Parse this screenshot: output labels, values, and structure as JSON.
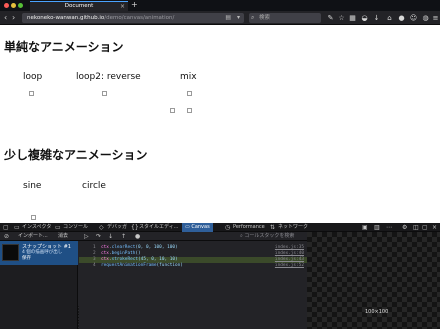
{
  "browser": {
    "tab_title": "Document",
    "tab_close": "×",
    "new_tab": "+",
    "url_host": "nekoneko-wanwan.github.io",
    "url_path": "/demo/canvas/animation/",
    "search_placeholder": "検索",
    "icons": [
      "back-arrow-icon",
      "forward-arrow-icon",
      "reader-icon",
      "search-icon",
      "pen-icon",
      "star-icon",
      "library-icon",
      "pocket-icon",
      "home-icon",
      "chat-icon",
      "smiley-icon",
      "menu-icon"
    ]
  },
  "page": {
    "section1_title": "単純なアニメーション",
    "loop": "loop",
    "loop2": "loop2: reverse",
    "mix": "mix",
    "section2_title": "少し複雑なアニメーション",
    "sine": "sine",
    "circle": "circle"
  },
  "devtools": {
    "tabs": [
      "インスペクタ",
      "コンソール",
      "デバッガ",
      "スタイルエディ...",
      "Canvas",
      "Performance",
      "ネットワーク"
    ],
    "active_tab": "Canvas",
    "toolbar_import": "インポート...",
    "toolbar_clear": "消去",
    "search_placeholder": "コールスタックを検索",
    "snapshot_title": "スナップショット #1",
    "snapshot_sub": "4 個の描画呼び出し",
    "snapshot_save": "保存",
    "code_lines": [
      {
        "num": "1",
        "obj": "ctx",
        "fn": "clearRect",
        "args": "(0, 0, 100, 100)",
        "loc": "index.js:35",
        "hl": false
      },
      {
        "num": "2",
        "obj": "ctx",
        "fn": "beginPath",
        "args": "()",
        "loc": "index.js:40",
        "hl": false
      },
      {
        "num": "3",
        "obj": "ctx",
        "fn": "strokeRect",
        "args": "(45, 0, 10, 10)",
        "loc": "index.js:43",
        "hl": true
      },
      {
        "num": "4",
        "obj": "",
        "fn": "requestAnimationFrame",
        "args": "(function)",
        "loc": "index.js:52",
        "hl": false
      }
    ],
    "preview_size": "100×100"
  }
}
